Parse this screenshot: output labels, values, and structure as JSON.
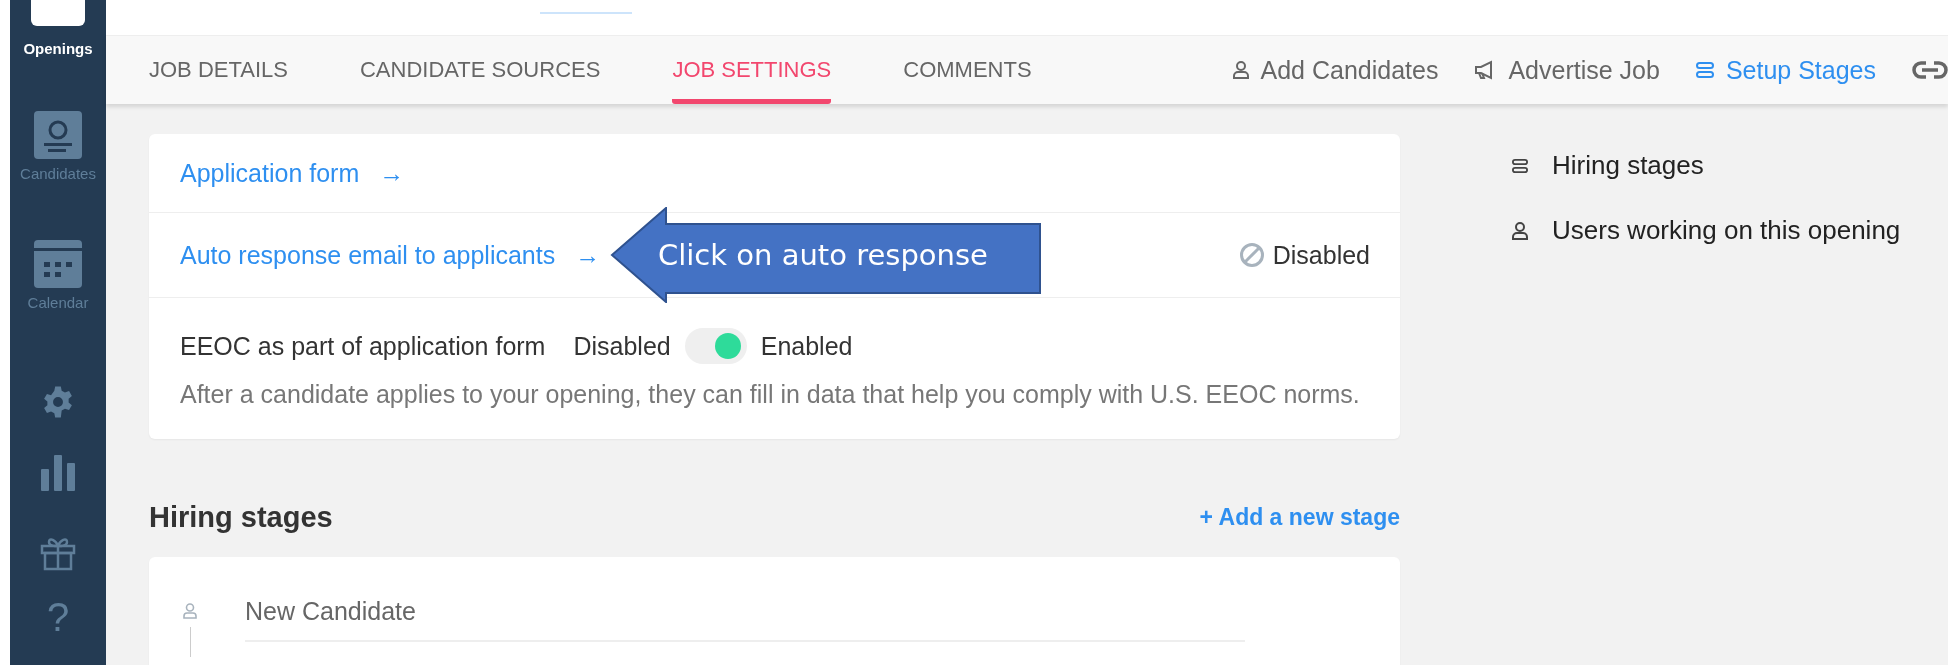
{
  "sidebar": {
    "items": [
      {
        "kind": "logo",
        "label": "Openings",
        "selected": true
      },
      {
        "kind": "candidates",
        "label": "Candidates",
        "selected": false
      },
      {
        "kind": "calendar",
        "label": "Calendar",
        "selected": false
      },
      {
        "kind": "gear",
        "selected": false
      },
      {
        "kind": "chart",
        "selected": false
      },
      {
        "kind": "gift",
        "selected": false
      },
      {
        "kind": "help",
        "glyph": "?",
        "selected": false
      }
    ]
  },
  "tabs": [
    {
      "label": "JOB DETAILS",
      "selected": false
    },
    {
      "label": "CANDIDATE SOURCES",
      "selected": false
    },
    {
      "label": "JOB SETTINGS",
      "selected": true
    },
    {
      "label": "COMMENTS",
      "selected": false
    }
  ],
  "actions": [
    {
      "kind": "person",
      "label": "Add Candidates",
      "selected": false
    },
    {
      "kind": "megaphone",
      "label": "Advertise Job",
      "selected": false
    },
    {
      "kind": "stages",
      "label": "Setup Stages",
      "selected": true
    },
    {
      "kind": "link",
      "selected": false
    }
  ],
  "settings": {
    "application_form": "Application form",
    "arrow_1": "→",
    "auto_response": "Auto response email to applicants",
    "arrow_2": "→",
    "auto_response_status": "Disabled",
    "eeoc_label": "EEOC as part of application form",
    "toggle_off_label": "Disabled",
    "toggle_on": true,
    "toggle_on_label": "Enabled",
    "eeoc_note": "After a candidate applies to your opening, they can fill in data that help you comply with U.S. EEOC norms."
  },
  "hiring_stages": {
    "title": "Hiring stages",
    "add_link": "+ Add a new stage",
    "stages": [
      {
        "name": "New Candidate"
      }
    ]
  },
  "side_links": [
    {
      "kind": "stages",
      "label": "Hiring stages"
    },
    {
      "kind": "person",
      "label": "Users working on this opening"
    }
  ],
  "callout": {
    "text": "Click on auto response"
  }
}
